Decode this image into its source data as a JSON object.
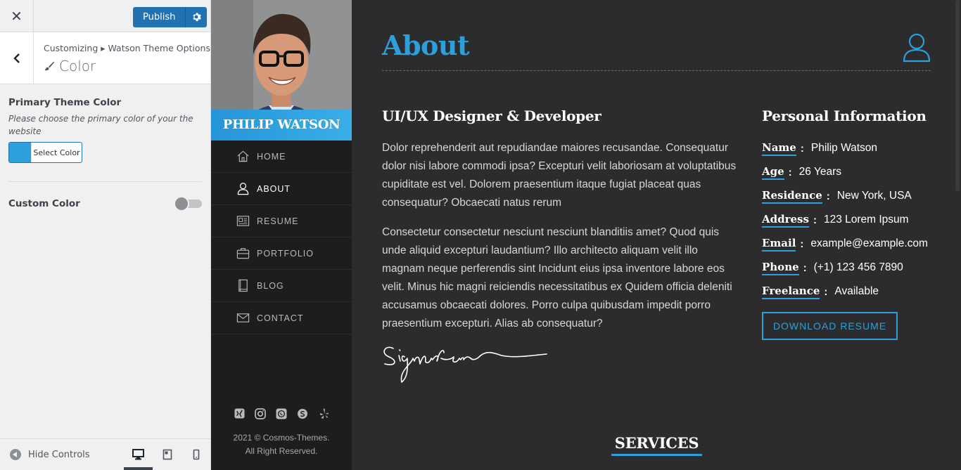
{
  "customizer": {
    "close_glyph": "✕",
    "publish_label": "Publish",
    "breadcrumb": "Customizing ▸ Watson Theme Options",
    "section_title": "Color",
    "primary_color_label": "Primary Theme Color",
    "primary_color_desc": "Please choose the primary color of your the website",
    "select_color_label": "Select Color",
    "selected_color": "#2d9fdb",
    "custom_color_label": "Custom Color",
    "custom_color_enabled": false,
    "hide_controls_label": "Hide Controls",
    "preview_device": "desktop"
  },
  "site": {
    "profile_name": "PHILIP WATSON",
    "nav": [
      {
        "label": "HOME",
        "icon": "home-icon"
      },
      {
        "label": "ABOUT",
        "icon": "user-icon",
        "active": true
      },
      {
        "label": "RESUME",
        "icon": "resume-icon"
      },
      {
        "label": "PORTFOLIO",
        "icon": "briefcase-icon"
      },
      {
        "label": "BLOG",
        "icon": "book-icon"
      },
      {
        "label": "CONTACT",
        "icon": "envelope-icon"
      }
    ],
    "social_icons": [
      "xing-icon",
      "instagram-icon",
      "whatsapp-icon",
      "skype-icon",
      "yelp-icon"
    ],
    "copyright_line1": "2021 © Cosmos-Themes.",
    "copyright_line2": "All Right Reserved."
  },
  "main": {
    "page_title": "About",
    "about_heading": "UI/UX Designer & Developer",
    "about_p1": "Dolor reprehenderit aut repudiandae maiores recusandae. Consequatur dolor nisi labore commodi ipsa? Excepturi velit laboriosam at voluptatibus cupiditate est vel. Dolorem praesentium itaque fugiat placeat quas consequatur? Obcaecati natus rerum",
    "about_p2": "Consectetur consectetur nesciunt nesciunt blanditiis amet? Quod quis unde aliquid excepturi laudantium? Illo architecto aliquam velit illo magnam neque perferendis sint Incidunt eius ipsa inventore labore eos velit. Minus hic magni reiciendis necessitatibus ex Quidem officia deleniti accusamus obcaecati dolores. Porro culpa quibusdam impedit porro praesentium excepturi. Alias ab consequatur?",
    "info_heading": "Personal Information",
    "info": [
      {
        "key": "Name",
        "value": "Philip Watson"
      },
      {
        "key": "Age",
        "value": "26 Years"
      },
      {
        "key": "Residence",
        "value": "New York, USA"
      },
      {
        "key": "Address",
        "value": "123 Lorem Ipsum"
      },
      {
        "key": "Email",
        "value": "example@example.com"
      },
      {
        "key": "Phone",
        "value": "(+1) 123 456 7890"
      },
      {
        "key": "Freelance",
        "value": "Available"
      }
    ],
    "info_separator": ":",
    "download_label": "DOWNLOAD RESUME",
    "services_heading": "SERVICES"
  },
  "colors": {
    "accent": "#2d9fdb",
    "wp_blue": "#2271b1",
    "main_bg": "#2c2c2e",
    "sidebar_bg": "#1c1d1f"
  }
}
